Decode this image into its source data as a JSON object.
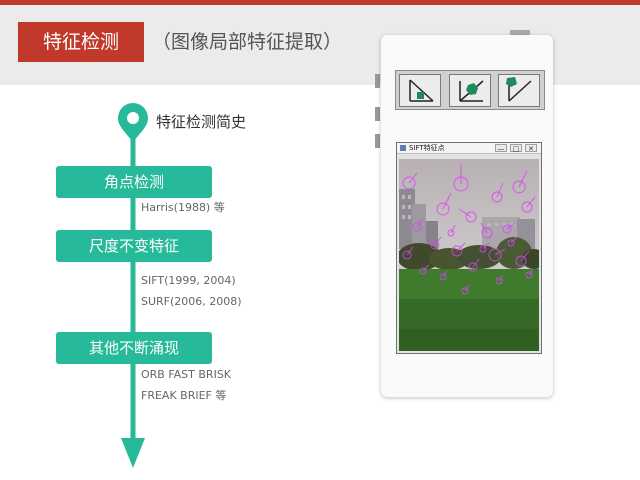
{
  "header": {
    "title": "特征检测",
    "subtitle": "（图像局部特征提取）"
  },
  "timeline": {
    "heading": "特征检测简史",
    "steps": [
      {
        "label": "角点检测",
        "notes": [
          "Harris(1988) 等"
        ]
      },
      {
        "label": "尺度不变特征",
        "notes": [
          "SIFT(1999, 2004)",
          "SURF(2006, 2008)"
        ]
      },
      {
        "label": "其他不断涌现",
        "notes": [
          "ORB  FAST  BRISK",
          "FREAK BRIEF 等"
        ]
      }
    ]
  },
  "demo": {
    "window_title": "SIFT特征点",
    "window_buttons": [
      "—",
      "□",
      "✕"
    ]
  },
  "colors": {
    "accent_red": "#c0392b",
    "accent_teal": "#26b99a",
    "keypoint_magenta": "#e040fb"
  }
}
